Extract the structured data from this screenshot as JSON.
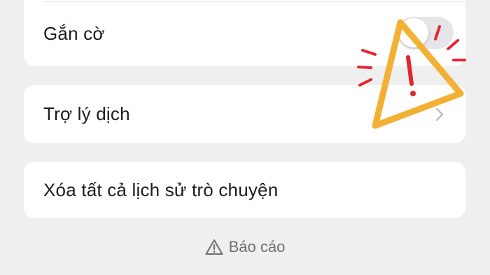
{
  "rows": {
    "flag_label": "Gắn cờ",
    "flag_toggle_on": false,
    "translate_label": "Trợ lý dịch",
    "clear_label": "Xóa tất cả lịch sử trò chuyện"
  },
  "footer": {
    "report_label": "Báo cáo"
  },
  "icons": {
    "toggle": "toggle-switch",
    "chevron": "chevron-right-icon",
    "report": "warning-triangle-icon",
    "overlay": "warning-sign-overlay"
  },
  "colors": {
    "background": "#efefef",
    "card": "#ffffff",
    "text": "#1c1c1e",
    "secondary_text": "#6e6e73",
    "toggle_off": "#e5e5ea",
    "overlay_triangle": "#f2b134",
    "overlay_accent": "#e3262f"
  }
}
